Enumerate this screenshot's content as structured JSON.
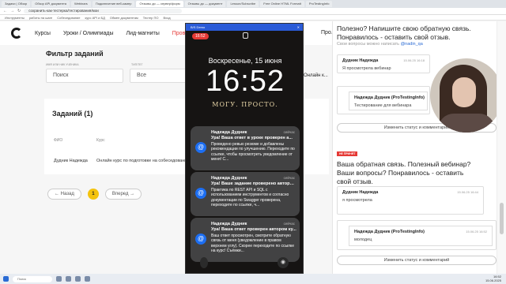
{
  "browser": {
    "tabs": [
      "Задачи | Обзор",
      "Обзор API документа",
      "Webinars",
      "Подключение веб-камер",
      "Отзывы до — сервер/форм",
      "Отзывы до — документ",
      "Lesson/Subscribe",
      "Free Online HTML Formatt",
      "ProTestingInfo"
    ],
    "url": "сохранить-как-тестерка/тестирования/мои",
    "bookmarks": [
      "Инструменты",
      "работы на шаге",
      "Собеседование",
      "курс API и БД",
      "Обмен документам",
      "Тестер ПО",
      "Вход"
    ]
  },
  "site": {
    "nav": {
      "courses": "Курсы",
      "lessons": "Уроки / Олимпиады",
      "leadmagnets": "Лид-магниты",
      "check": "Проверка за...",
      "profile": "Про..."
    },
    "filter": {
      "title": "Фильтр заданий",
      "name_label": "Имя или ник ученика",
      "type_label": "Тип/Тег",
      "search_placeholder": "Поиск",
      "select_value": "Все",
      "online_label": "Онлайн к..."
    },
    "tasks": {
      "title": "Заданий (1)",
      "col_name": "ФИО",
      "col_course": "Курс",
      "row_name": "Дудник Надежда",
      "row_course": "Онлайн курс по подготовке на собеседование /"
    },
    "pager": {
      "prev": "← Назад",
      "page": "1",
      "next": "Вперед →"
    }
  },
  "phone": {
    "window_title": "B/S Demo",
    "status_time": "16:52",
    "date": "Воскресенье, 15 июня",
    "time": "16:52",
    "motto": "МОГУ. ПРОСТО.",
    "notifications": [
      {
        "title": "Надежда Дудник",
        "time": "сейчас",
        "subtitle": "Ура! Ваша ответ в уроке проверен а...",
        "body": "Проведено ревью резюме и добавлены рекомендации по улучшению. Переходите по ссылке, чтобы просмотреть уведомление от меня! С..."
      },
      {
        "title": "Надежда Дудник",
        "time": "сейчас",
        "subtitle": "Ура! Ваше задание проверено автором к...",
        "body": "Практика по REST API и SQL с использованием инструментов и согласно документации по Swagger проверена, переходите по ссылке, ч..."
      },
      {
        "title": "Надежда Дудник",
        "time": "сейчас",
        "subtitle": "Ура! Ваша ответ проверен автором ку...",
        "body": "Ваш ответ просмотрен, смотрите обратную связь от меня (уведомление в правом верхнем углу). Скорее переходите по ссылке на курс! Съёмки..."
      }
    ]
  },
  "feedback": {
    "block1": {
      "heading": "Полезно? Напишите свою обратную связь. Понравилось - оставить свой отзыв.",
      "note_prefix": "Свои вопросы можно написать ",
      "note_link": "@nadin_qa",
      "card1": {
        "who": "Дудник Надежда",
        "when": "15.06.25 16:18",
        "msg": "Я просмотрела вебинар"
      },
      "card2": {
        "who": "Надежда Дудник (ProTestingInfo)",
        "when": "15.06.25 16:43",
        "msg": "Тестирование для вебинара"
      },
      "status_button": "Изменить статус и комментарий"
    },
    "badge": "НЕ ПРИНЯТ",
    "block2": {
      "heading": "Ваша обратная связь. Полезный вебинар? Ваши вопросы? Понравилось - оставить свой отзыв.",
      "card1": {
        "who": "Дудник Надежда",
        "when": "15.06.25 16:44",
        "msg": "я просмотрела"
      },
      "card2": {
        "who": "Надежда Дудник (ProTestingInfo)",
        "when": "15.06.25 16:52",
        "msg": "молодец"
      },
      "status_button": "Изменить статус и комментарий"
    }
  },
  "taskbar": {
    "search": "Поиск",
    "time": "16:52",
    "date": "15.06.2025"
  }
}
